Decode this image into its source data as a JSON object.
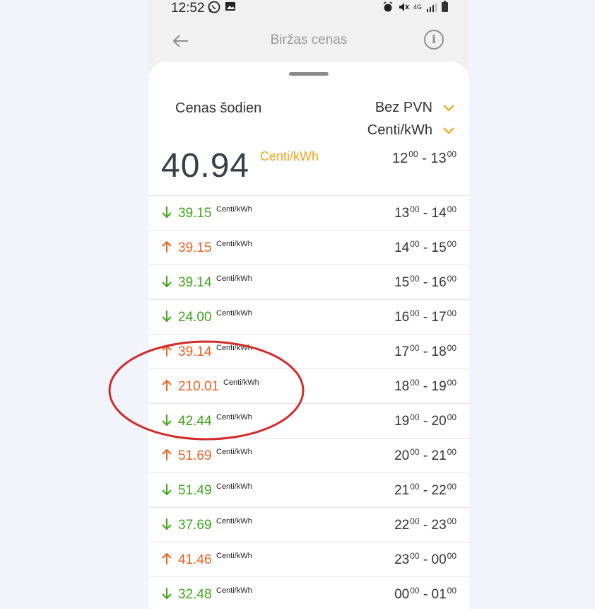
{
  "status_bar": {
    "time": "12:52",
    "network": "4G"
  },
  "app_bar": {
    "title": "Biržas cenas",
    "info_label": "i"
  },
  "header": {
    "today_label": "Cenas šodien",
    "vat_option": "Bez PVN",
    "unit_option": "Centi/kWh",
    "current_price": "40.94",
    "current_unit": "Centi/kWh",
    "current_from": "12",
    "current_to": "13",
    "minutes": "00"
  },
  "unit_label": "Centi/kWh",
  "rows": [
    {
      "price": "39.15",
      "trend": "down",
      "from": "13",
      "to": "14"
    },
    {
      "price": "39.15",
      "trend": "up",
      "from": "14",
      "to": "15"
    },
    {
      "price": "39.14",
      "trend": "down",
      "from": "15",
      "to": "16"
    },
    {
      "price": "24.00",
      "trend": "down",
      "from": "16",
      "to": "17"
    },
    {
      "price": "39.14",
      "trend": "up",
      "from": "17",
      "to": "18"
    },
    {
      "price": "210.01",
      "trend": "up",
      "from": "18",
      "to": "19"
    },
    {
      "price": "42.44",
      "trend": "down",
      "from": "19",
      "to": "20"
    },
    {
      "price": "51.69",
      "trend": "up",
      "from": "20",
      "to": "21"
    },
    {
      "price": "51.49",
      "trend": "down",
      "from": "21",
      "to": "22"
    },
    {
      "price": "37.69",
      "trend": "down",
      "from": "22",
      "to": "23"
    },
    {
      "price": "41.46",
      "trend": "up",
      "from": "23",
      "to": "00"
    },
    {
      "price": "32.48",
      "trend": "down",
      "from": "00",
      "to": "01"
    }
  ],
  "colors": {
    "down": "#3ea61a",
    "up": "#f0601f",
    "accent": "#f2a31b",
    "annotation": "#d42a2a"
  }
}
